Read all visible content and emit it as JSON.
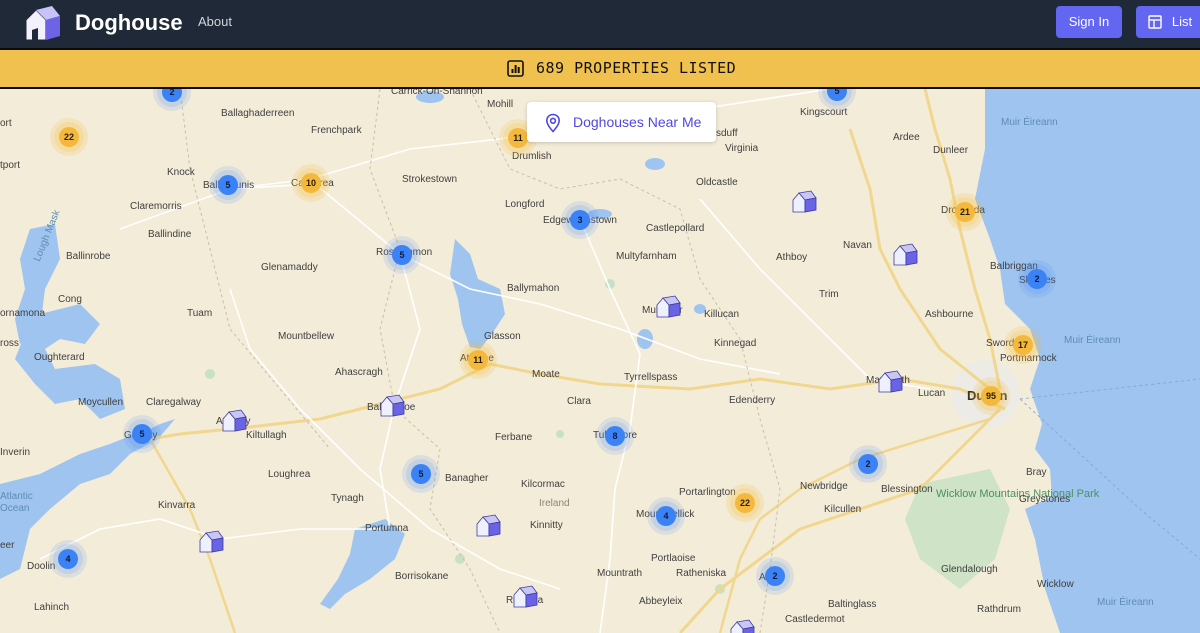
{
  "header": {
    "brand": "Doghouse",
    "about": "About",
    "sign_in": "Sign In",
    "list": "List",
    "logo_icon": "doghouse-logo",
    "list_icon": "layout-icon"
  },
  "banner": {
    "text": "689 PROPERTIES LISTED",
    "icon": "bar-chart-icon",
    "color": "#f1c14f"
  },
  "near_me": {
    "label": "Doghouses Near Me",
    "icon": "map-pin-icon"
  },
  "colors": {
    "accent": "#6366f1",
    "header_bg": "#1f2937",
    "cluster_blue": "#3b82f6",
    "cluster_yellow": "#f4b93c",
    "water": "#9ec4ef",
    "land": "#f3ecd9"
  },
  "map": {
    "places": {
      "carrick": "Carrick-On-Shannon",
      "mohill": "Mohill",
      "kingscourt": "Kingscourt",
      "ballaghaderreen": "Ballaghaderreen",
      "frenchpark": "Frenchpark",
      "drumlish": "Drumlish",
      "bailieborough": "sduff",
      "virginia": "Virginia",
      "ardee": "Ardee",
      "dunleer": "Dunleer",
      "knock": "Knock",
      "ballyhaunis": "Ballyhaunis",
      "castlerea": "Castlerea",
      "strokestown": "Strokestown",
      "oldcastle": "Oldcastle",
      "claremorris": "Claremorris",
      "longford": "Longford",
      "edgeworthstown": "Edgeworthstown",
      "castlepollard": "Castlepollard",
      "drogheda": "Drogheda",
      "ballindine": "Ballindine",
      "roscommon": "Roscommon",
      "navan": "Navan",
      "ballinrobe": "Ballinrobe",
      "glenamaddy": "Glenamaddy",
      "multyfarnham": "Multyfarnham",
      "athboy": "Athboy",
      "balbriggan": "Balbriggan",
      "skerries": "Skerries",
      "cong": "Cong",
      "ballymahon": "Ballymahon",
      "trim": "Trim",
      "tuam": "Tuam",
      "mullingar": "Mullingar",
      "killucan": "Killucan",
      "ashbourne": "Ashbourne",
      "mountbellew": "Mountbellew",
      "glasson": "Glasson",
      "kinnegad": "Kinnegad",
      "swords": "Swords",
      "portmarnock": "Portmarnock",
      "oughterard": "Oughterard",
      "athlone": "Athlone",
      "ahascragh": "Ahascragh",
      "moate": "Moate",
      "tyrrellspass": "Tyrrellspass",
      "maynooth": "Maynooth",
      "moycullen": "Moycullen",
      "claregalway": "Claregalway",
      "ballinasloe": "Ballinasloe",
      "clara": "Clara",
      "edenderry": "Edenderry",
      "lucan": "Lucan",
      "dublin": "Dublin",
      "galway": "Galway",
      "athenry": "Athenry",
      "kiltullagh": "Kiltullagh",
      "ferbane": "Ferbane",
      "tullamore": "Tullamore",
      "inverin": "Inverin",
      "loughrea": "Loughrea",
      "banagher": "Banagher",
      "newbridge": "Newbridge",
      "blessington": "Blessington",
      "bray": "Bray",
      "kilcormac": "Kilcormac",
      "ireland": "Ireland",
      "portarlington": "Portarlington",
      "atlantic": "Atlantic",
      "ocean": "Ocean",
      "tynagh": "Tynagh",
      "kinvarra": "Kinvarra",
      "kinnitty": "Kinnitty",
      "mountmellick": "Mountmellick",
      "kilcullen": "Kilcullen",
      "wicklow_mtns": "Wicklow Mountains National Park",
      "greystones": "Greystones",
      "portumna": "Portumna",
      "portlaoise": "Portlaoise",
      "doolin": "Doolin",
      "borrisokane": "Borrisokane",
      "mountrath": "Mountrath",
      "ratheniska": "Ratheniska",
      "athy": "Athy",
      "glendalough": "Glendalough",
      "wicklow": "Wicklow",
      "lahinch": "Lahinch",
      "roscrea": "Roscrea",
      "abbeyleix": "Abbeyleix",
      "baltinglass": "Baltinglass",
      "rathdrum": "Rathdrum",
      "castledermot": "Castledermot",
      "muir1": "Muir Éireann",
      "muir2": "Muir Éireann",
      "muir3": "Muir Éireann",
      "lough_mask": "Lough Mask",
      "ort": "ort",
      "tport": "tport",
      "ornamona": "ornamona",
      "ross": "ross",
      "eer": "eer"
    },
    "clusters": [
      {
        "count": "2",
        "color": "blue"
      },
      {
        "count": "22",
        "color": "yellow"
      },
      {
        "count": "11",
        "color": "yellow"
      },
      {
        "count": "5",
        "color": "blue"
      },
      {
        "count": "5",
        "color": "blue"
      },
      {
        "count": "10",
        "color": "yellow"
      },
      {
        "count": "3",
        "color": "blue"
      },
      {
        "count": "21",
        "color": "yellow"
      },
      {
        "count": "5",
        "color": "blue"
      },
      {
        "count": "2",
        "color": "blue"
      },
      {
        "count": "17",
        "color": "yellow"
      },
      {
        "count": "11",
        "color": "yellow"
      },
      {
        "count": "95",
        "color": "yellow"
      },
      {
        "count": "5",
        "color": "blue"
      },
      {
        "count": "8",
        "color": "blue"
      },
      {
        "count": "2",
        "color": "blue"
      },
      {
        "count": "5",
        "color": "blue"
      },
      {
        "count": "22",
        "color": "yellow"
      },
      {
        "count": "4",
        "color": "blue"
      },
      {
        "count": "4",
        "color": "blue"
      },
      {
        "count": "2",
        "color": "blue"
      }
    ],
    "property_markers": 10
  }
}
